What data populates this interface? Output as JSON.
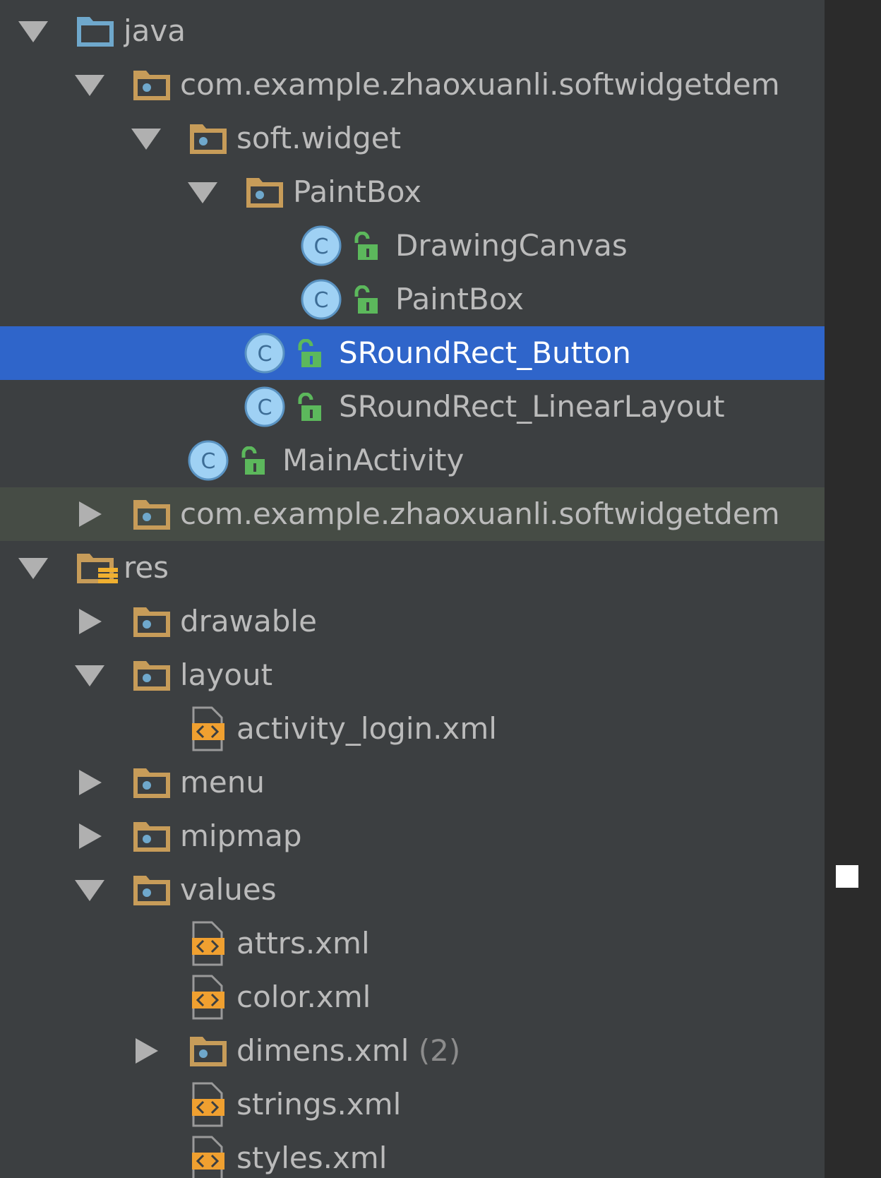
{
  "project_tree": {
    "items": [
      {
        "label": "java",
        "icon": "source-root-folder-icon",
        "expanded": true
      },
      {
        "label": "com.example.zhaoxuanli.softwidgetdem",
        "icon": "package-folder-icon",
        "expanded": true
      },
      {
        "label": "soft.widget",
        "icon": "package-folder-icon",
        "expanded": true
      },
      {
        "label": "PaintBox",
        "icon": "package-folder-icon",
        "expanded": true
      },
      {
        "label": "DrawingCanvas",
        "icon": "class-icon"
      },
      {
        "label": "PaintBox",
        "icon": "class-icon"
      },
      {
        "label": "SRoundRect_Button",
        "icon": "class-icon",
        "selected": true
      },
      {
        "label": "SRoundRect_LinearLayout",
        "icon": "class-icon"
      },
      {
        "label": "MainActivity",
        "icon": "class-icon"
      },
      {
        "label": "com.example.zhaoxuanli.softwidgetdem",
        "icon": "package-folder-icon",
        "expanded": false
      },
      {
        "label": "res",
        "icon": "resources-folder-icon",
        "expanded": true
      },
      {
        "label": "drawable",
        "icon": "package-folder-icon",
        "expanded": false
      },
      {
        "label": "layout",
        "icon": "package-folder-icon",
        "expanded": true
      },
      {
        "label": "activity_login.xml",
        "icon": "xml-file-icon"
      },
      {
        "label": "menu",
        "icon": "package-folder-icon",
        "expanded": false
      },
      {
        "label": "mipmap",
        "icon": "package-folder-icon",
        "expanded": false
      },
      {
        "label": "values",
        "icon": "package-folder-icon",
        "expanded": true
      },
      {
        "label": "attrs.xml",
        "icon": "xml-file-icon"
      },
      {
        "label": "color.xml",
        "icon": "xml-file-icon"
      },
      {
        "label": "dimens.xml",
        "count": "(2)",
        "icon": "package-folder-icon",
        "expanded": false
      },
      {
        "label": "strings.xml",
        "icon": "xml-file-icon"
      },
      {
        "label": "styles.xml",
        "icon": "xml-file-icon"
      }
    ]
  },
  "colors": {
    "background": "#3c3f41",
    "selection": "#2f65ca",
    "hover": "#464c45",
    "text": "#bbbbbb",
    "folder": "#c79c59",
    "class_badge": "#9fd1f4",
    "lock": "#5cb85c",
    "xml": "#f0a030"
  }
}
